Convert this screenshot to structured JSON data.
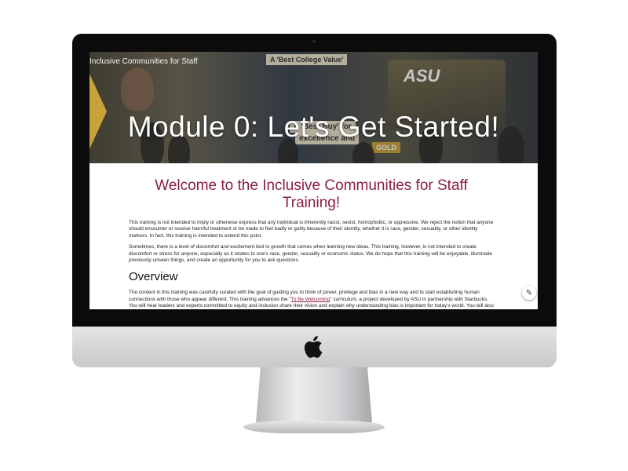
{
  "course": {
    "title": "Inclusive Communities for Staff"
  },
  "hero": {
    "module_title": "Module 0: Let's Get Started!",
    "signs": [
      "A 'Best College Value'",
      "A 'Best Buy' for",
      "excellence and",
      "ASU",
      "GOLD"
    ]
  },
  "main": {
    "welcome_heading": "Welcome to the Inclusive Communities for Staff Training!",
    "para1": "This training is not intended to imply or otherwise express that any individual is inherently racist, sexist, homophobic, or oppressive. We reject the notion that anyone should encounter or receive harmful treatment or be made to feel badly or guilty because of their identity, whether it is race, gender, sexuality, or other identity markers. In fact, this training is intended to extend this point.",
    "para2": "Sometimes, there is a level of discomfort and excitement tied to growth that comes when learning new ideas. This training, however, is not intended to create discomfort or stress for anyone, especially as it relates to one's race, gender, sexuality or economic status. We do hope that this training will be enjoyable, illuminate previously unseen things, and create an opportunity for you to ask questions.",
    "overview_heading": "Overview",
    "para3_before": "The content in this training was carefully curated with the goal of guiding you to think of power, privilege and bias in a new way and to start establishing human connections with those who appear different. This training advances the \"",
    "para3_link": "To Be Welcoming",
    "para3_after": "\" curriculum, a project developed by ASU in partnership with Starbucks. You will hear leaders and experts committed to equity and inclusion share their vision and explain why understanding bias is important for today's world. You will also learn why dialogue, reflection and informed action are necessary to find a common ground that generates a sense of shared human connection and facilitates moving beyond biases that marginalize others and ourselves."
  },
  "icons": {
    "edit": "pencil-icon",
    "brand": "apple-icon"
  },
  "colors": {
    "accent": "#8c1d40",
    "gold": "#c9a23a"
  }
}
